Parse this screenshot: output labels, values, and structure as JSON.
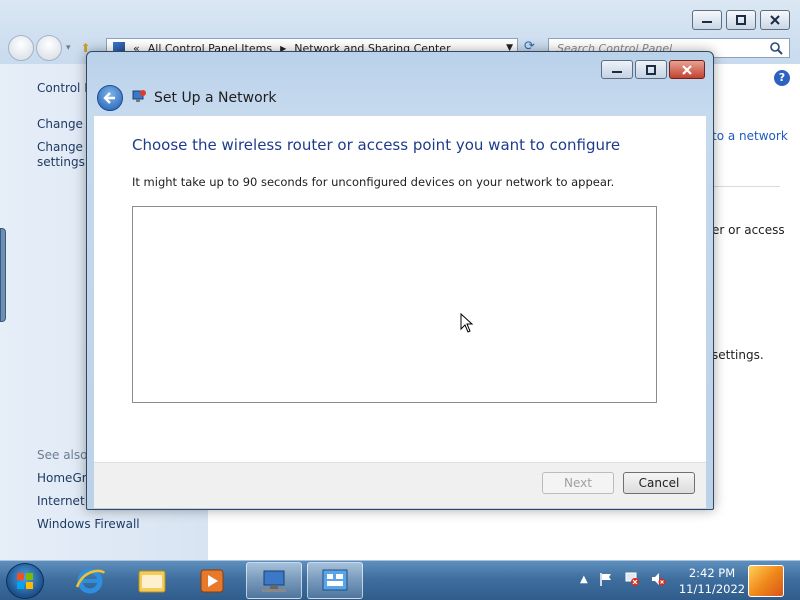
{
  "explorer": {
    "address_prefix": "«",
    "address_crumbs": [
      "All Control Panel Items",
      "Network and Sharing Center"
    ],
    "search_placeholder": "Search Control Panel",
    "sidebar": {
      "control_panel_home": "Control P",
      "change_adapter": "Change a",
      "change_advanced_1": "Change a",
      "change_advanced_2": "settings",
      "see_also": "See also",
      "homegroup": "HomeGro",
      "internet_options": "Internet C",
      "windows_firewall": "Windows Firewall"
    },
    "right_fragments": {
      "to_a_network": "to a network",
      "or_access": "er or access",
      "settings": "settings."
    }
  },
  "dialog": {
    "title": "Set Up a Network",
    "heading": "Choose the wireless router or access point you want to configure",
    "description": "It might take up to 90 seconds for unconfigured devices on your network to appear.",
    "next_label": "Next",
    "cancel_label": "Cancel",
    "next_enabled": false
  },
  "taskbar": {
    "time": "2:42 PM",
    "date": "11/11/2022",
    "pinned": [
      "start-icon",
      "internet-explorer-icon",
      "windows-explorer-icon",
      "media-player-icon",
      "network-setup-icon",
      "control-panel-icon"
    ]
  },
  "colors": {
    "accent_heading": "#1e3c8c",
    "link": "#1e5cbf",
    "taskbar": "#3f6f9f"
  }
}
